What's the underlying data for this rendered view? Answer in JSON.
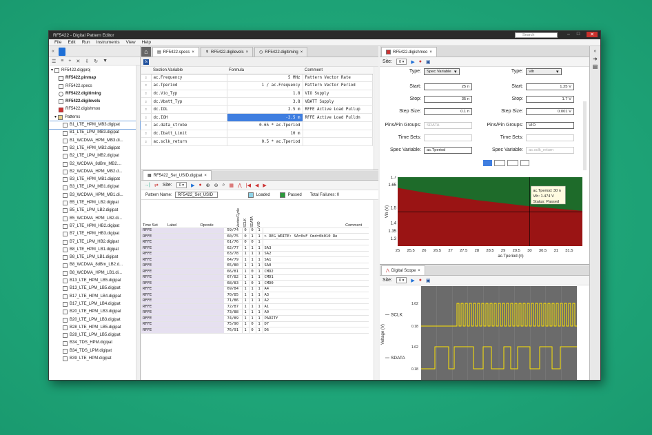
{
  "window": {
    "title": "RF5422 - Digital Pattern Editor",
    "search_placeholder": "Search"
  },
  "menu": [
    "File",
    "Edit",
    "Run",
    "Instruments",
    "View",
    "Help"
  ],
  "project": {
    "root": "RF5422.digiproj",
    "files": [
      "RF5422.pinmap",
      "RF5422.specs",
      "RF5422.digitiming",
      "RF5422.digilevels",
      "RF5422.digishmoo"
    ],
    "patterns_label": "Patterns",
    "patterns": [
      "B1_LTE_HPM_MB3.digipat",
      "B1_LTE_LPM_MB3.digipat",
      "B1_WCDMA_HPM_MB3.di...",
      "B2_LTE_HPM_MB2.digipat",
      "B2_LTE_LPM_MB2.digipat",
      "B2_WCDMA_8dBm_MB2....",
      "B2_WCDMA_HPM_MB2.d...",
      "B3_LTE_HPM_MB1.digipat",
      "B3_LTE_LPM_MB1.digipat",
      "B3_WCDMA_HPM_MB1.di...",
      "B5_LTE_HPM_LB2.digipat",
      "B5_LTE_LPM_LB2.digipat",
      "B5_WCDMA_HPM_LB2.di...",
      "B7_LTE_HPM_HB2.digipat",
      "B7_LTE_HPM_HB3.digipat",
      "B7_LTE_LPM_HB2.digipat",
      "B8_LTE_HPM_LB1.digipat",
      "B8_LTE_LPM_LB1.digipat",
      "B8_WCDMA_8dBm_LB2.d...",
      "B8_WCDMA_HPM_LB1.di...",
      "B13_LTE_HPM_LB5.digipat",
      "B13_LTE_LPM_LB5.digipat",
      "B17_LTE_HPM_LB4.digipat",
      "B17_LTE_LPM_LB4.digipat",
      "B20_LTE_HPM_LB3.digipat",
      "B20_LTE_LPM_LB3.digipat",
      "B28_LTE_HPM_LB5.digipat",
      "B28_LTE_LPM_LB5.digipat",
      "B34_TDS_HPM.digipat",
      "B34_TDS_LPM.digipat",
      "B39_LTE_HPM.digipat"
    ]
  },
  "center_tabs": [
    "RF5422.specs",
    "RF5422.digilevels",
    "RF5422.digitiming"
  ],
  "specs": {
    "headers": [
      "Section.Variable",
      "Formula",
      "Comment"
    ],
    "rows": [
      [
        "ac.Frequency",
        "5 MHz",
        "Pattern Vector Rate"
      ],
      [
        "ac.Tperiod",
        "1 / ac.Frequency",
        "Pattern Vector Period"
      ],
      [
        "dc.Vio_Typ",
        "1.8",
        "VIO Supply"
      ],
      [
        "dc.Vbatt_Typ",
        "3.8",
        "VBATT Supply"
      ],
      [
        "dc.IOL",
        "2.5 m",
        "RFFE Active Load Pullup"
      ],
      [
        "dc.IOH",
        "-2.5 m",
        "RFFE Active Load Pulldn"
      ],
      [
        "ac.data_strobe",
        "0.65 * ac.Tperiod",
        ""
      ],
      [
        "dc.Ibatt_Limit",
        "10 m",
        ""
      ],
      [
        "ac.sclk_return",
        "0.5 * ac.Tperiod",
        ""
      ]
    ]
  },
  "digipat": {
    "tab": "RF5422_Set_USID.digipat",
    "site_label": "Site:",
    "site_value": "0",
    "pattern_name_label": "Pattern Name:",
    "pattern_name": "RF5422_Set_USID",
    "loaded": "Loaded",
    "passed": "Passed",
    "failures": "Total Failures: 0",
    "headers": [
      "Time Set",
      "Label",
      "Opcode",
      "Vector/Cycle",
      "SCLK",
      "SDATA",
      "VIO",
      "Comment"
    ],
    "rows": [
      [
        "RFFE",
        "59/74",
        "0",
        "0",
        "1",
        ""
      ],
      [
        "RFFE",
        "60/75",
        "0",
        "1",
        "1",
        "> REG_WRITE:  SA=0xF  Cmd=0b010  Re"
      ],
      [
        "RFFE",
        "61/76",
        "0",
        "0",
        "1",
        ""
      ],
      [
        "RFFE",
        "62/77",
        "1",
        "1",
        "1",
        "SA3"
      ],
      [
        "RFFE",
        "63/78",
        "1",
        "1",
        "1",
        "SA2"
      ],
      [
        "RFFE",
        "64/79",
        "1",
        "1",
        "1",
        "SA1"
      ],
      [
        "RFFE",
        "65/80",
        "1",
        "1",
        "1",
        "SA0"
      ],
      [
        "RFFE",
        "66/81",
        "1",
        "0",
        "1",
        "CMD2"
      ],
      [
        "RFFE",
        "67/82",
        "1",
        "1",
        "1",
        "CMD1"
      ],
      [
        "RFFE",
        "68/83",
        "1",
        "0",
        "1",
        "CMD0"
      ],
      [
        "RFFE",
        "69/84",
        "1",
        "1",
        "1",
        "A4"
      ],
      [
        "RFFE",
        "70/85",
        "1",
        "1",
        "1",
        "A3"
      ],
      [
        "RFFE",
        "71/86",
        "1",
        "1",
        "1",
        "A2"
      ],
      [
        "RFFE",
        "72/87",
        "1",
        "1",
        "1",
        "A1"
      ],
      [
        "RFFE",
        "73/88",
        "1",
        "1",
        "1",
        "A0"
      ],
      [
        "RFFE",
        "74/89",
        "1",
        "1",
        "1",
        "PARITY"
      ],
      [
        "RFFE",
        "75/90",
        "1",
        "0",
        "1",
        "D7"
      ],
      [
        "RFFE",
        "76/91",
        "1",
        "0",
        "1",
        "D6"
      ]
    ]
  },
  "shmoo": {
    "tab": "RF5422.digishmoo",
    "site_label": "Site:",
    "site_value": "0",
    "x_axis": {
      "type_label": "Type:",
      "type": "Spec Variable",
      "start_label": "Start:",
      "start": "25 n",
      "stop_label": "Stop:",
      "stop": "35 n",
      "step_label": "Step Size:",
      "step": "0.1 n",
      "pins_label": "Pins/Pin Groups:",
      "pins": "SDATA",
      "timesets_label": "Time Sets:",
      "timesets": "",
      "specvar_label": "Spec Variable:",
      "specvar": "ac.Tperiod"
    },
    "y_axis": {
      "type_label": "Type:",
      "type": "Vih",
      "start_label": "Start:",
      "start": "1.25 V",
      "stop_label": "Stop:",
      "stop": "1.7 V",
      "step_label": "Step Size:",
      "step": "0.001 V",
      "pins_label": "Pins/Pin Groups:",
      "pins": "VIO",
      "timesets_label": "Time Sets:",
      "timesets": "",
      "specvar_label": "Spec Variable:",
      "specvar": "ac.sclk_return"
    },
    "tooltip": [
      "ac.Tperiod: 30 n",
      "Vih: 1.474 V",
      "Status: Passed"
    ],
    "xlabel": "ac.Tperiod (n)",
    "ylabel": "Vih (V)"
  },
  "scope": {
    "tab": "Digital Scope",
    "site_label": "Site:",
    "site_value": "0",
    "ylabel": "Voltage (V)",
    "signals": [
      {
        "name": "SCLK",
        "hi": "1.62",
        "lo": "0.18"
      },
      {
        "name": "SDATA",
        "hi": "1.62",
        "lo": "0.18"
      }
    ]
  },
  "chart_data": {
    "type": "heatmap",
    "title": "",
    "xlabel": "ac.Tperiod (n)",
    "ylabel": "Vih (V)",
    "xlim": [
      25,
      32
    ],
    "ylim": [
      1.25,
      1.7
    ],
    "x_ticks": [
      25,
      25.5,
      26,
      26.5,
      27,
      27.5,
      28,
      28.5,
      29,
      29.5,
      30,
      30.5,
      31,
      31.5
    ],
    "y_ticks": [
      1.3,
      1.35,
      1.4,
      1.45,
      1.5,
      1.55,
      1.6,
      1.65,
      1.7
    ],
    "boundary": {
      "x": [
        25,
        26,
        27,
        28,
        29,
        30,
        31,
        32
      ],
      "y": [
        1.63,
        1.6,
        1.575,
        1.55,
        1.53,
        1.51,
        1.495,
        1.48
      ]
    },
    "regions": [
      {
        "name": "Passed",
        "color": "#1e6b2a"
      },
      {
        "name": "Failed",
        "color": "#9a1414"
      }
    ],
    "cursor": {
      "x": 30,
      "y": 1.474
    }
  }
}
